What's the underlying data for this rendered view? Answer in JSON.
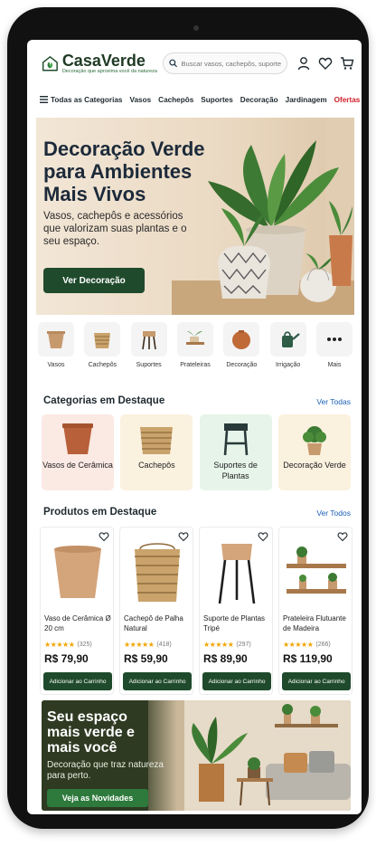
{
  "brand": {
    "name": "CasaVerde",
    "tagline": "Decoração que aproxima você da natureza"
  },
  "search": {
    "placeholder": "Buscar vasos, cachepôs, suportes..."
  },
  "nav": {
    "all_categories": "Todas as Categorias",
    "items": [
      "Vasos",
      "Cachepôs",
      "Suportes",
      "Decoração",
      "Jardinagem"
    ],
    "offers": "Ofertas"
  },
  "hero": {
    "title": "Decoração Verde para Ambientes Mais Vivos",
    "subtitle": "Vasos, cachepôs e acessórios que valorizam suas plantas e o seu espaço.",
    "button": "Ver Decoração"
  },
  "quick_categories": [
    {
      "label": "Vasos",
      "icon": "vase-icon"
    },
    {
      "label": "Cachepôs",
      "icon": "basket-icon"
    },
    {
      "label": "Suportes",
      "icon": "stand-icon"
    },
    {
      "label": "Prateleiras",
      "icon": "shelf-icon"
    },
    {
      "label": "Decoração",
      "icon": "deco-vase-icon"
    },
    {
      "label": "Irrigação",
      "icon": "watering-can-icon"
    },
    {
      "label": "Mais",
      "icon": "more-icon"
    }
  ],
  "featured_categories": {
    "title": "Categorias em Destaque",
    "link": "Ver Todas",
    "items": [
      {
        "label": "Vasos de Cerâmica",
        "bg": "#fbe9e4"
      },
      {
        "label": "Cachepôs",
        "bg": "#fbf1df"
      },
      {
        "label": "Suportes de Plantas",
        "bg": "#e7f4ea"
      },
      {
        "label": "Decoração Verde",
        "bg": "#fbf1df"
      }
    ]
  },
  "featured_products": {
    "title": "Produtos em Destaque",
    "link": "Ver Todos",
    "items": [
      {
        "name": "Vaso de Cerâmica Ø 20 cm",
        "stars": "★★★★★",
        "reviews": "(325)",
        "price": "R$ 79,90",
        "button": "Adicionar ao Carrinho"
      },
      {
        "name": "Cachepô de Palha Natural",
        "stars": "★★★★★",
        "reviews": "(418)",
        "price": "R$ 59,90",
        "button": "Adicionar ao Carrinho"
      },
      {
        "name": "Suporte de Plantas Tripé",
        "stars": "★★★★★",
        "reviews": "(297)",
        "price": "R$ 89,90",
        "button": "Adicionar ao Carrinho"
      },
      {
        "name": "Prateleira Flutuante de Madeira",
        "stars": "★★★★★",
        "reviews": "(266)",
        "price": "R$ 119,90",
        "button": "Adicionar ao Carrinho"
      }
    ]
  },
  "promo": {
    "title": "Seu espaço mais verde e mais você",
    "subtitle": "Decoração que traz natureza para perto.",
    "button": "Veja as Novidades"
  },
  "colors": {
    "primary": "#1f4a2c",
    "offers": "#d0202a",
    "link": "#1a5fb4"
  }
}
